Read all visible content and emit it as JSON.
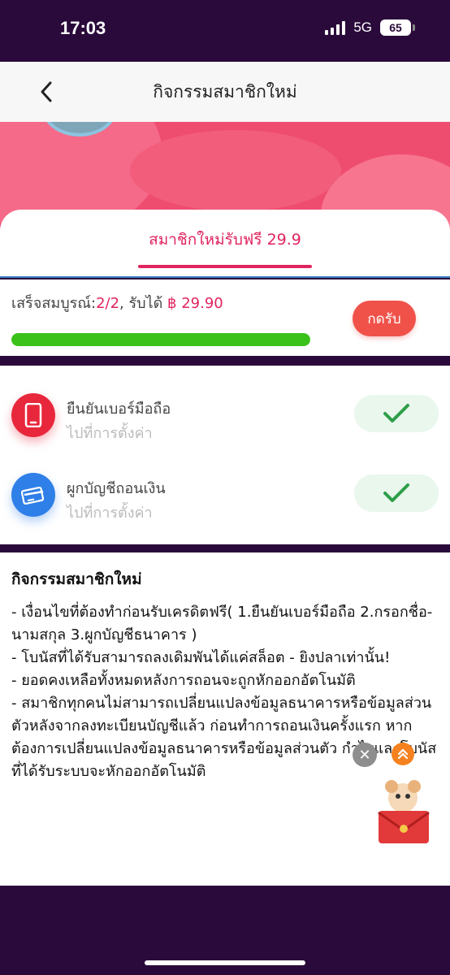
{
  "status": {
    "time": "17:03",
    "network": "5G",
    "battery": "65"
  },
  "nav": {
    "title": "กิจกรรมสมาชิกใหม่"
  },
  "tab": {
    "label": "สมาชิกใหม่รับฟรี 29.9"
  },
  "progress": {
    "label": "เสร็จสมบูรณ์:",
    "count": "2/2",
    "reward_label": ", รับได้",
    "reward": "฿ 29.90",
    "fraction": 1.0,
    "claim_label": "กดรับ"
  },
  "tasks": [
    {
      "name": "ยืนยันเบอร์มือถือ",
      "sub": "ไปที่การตั้งค่า",
      "icon": "phone-icon",
      "color": "#e8273c",
      "completed": true
    },
    {
      "name": "ผูกบัญชีถอนเงิน",
      "sub": "ไปที่การตั้งค่า",
      "icon": "bank-card-icon",
      "color": "#2f7fe8",
      "completed": true
    }
  ],
  "rules": {
    "title": "กิจกรรมสมาชิกใหม่",
    "lines": [
      "- เงื่อนไขที่ต้องทำก่อนรับเครดิตฟรี( 1.ยืนยันเบอร์มือถือ 2.กรอกชื่อ-นามสกุล 3.ผูกบัญชีธนาคาร )",
      "- โบนัสที่ได้รับสามารถลงเดิมพันได้แค่สล็อต - ยิงปลาเท่านั้น!",
      "- ยอดคงเหลือทั้งหมดหลังการถอนจะถูกหักออกอัตโนมัติ",
      "- สมาชิกทุกคนไม่สามารถเปลี่ยนแปลงข้อมูลธนาคารหรือข้อมูลส่วนตัวหลังจากลงทะเบียนบัญชีแล้ว ก่อนทำการถอนเงินครั้งแรก หากต้องการเปลี่ยนแปลงข้อมูลธนาคารหรือข้อมูลส่วนตัว กำไรและโบนัสที่ได้รับระบบจะหักออกอัตโนมัติ"
    ]
  },
  "colors": {
    "accent": "#e0245e",
    "success": "#3ac21a",
    "hero": "#ef4d70",
    "dark": "#2a0a3a"
  }
}
